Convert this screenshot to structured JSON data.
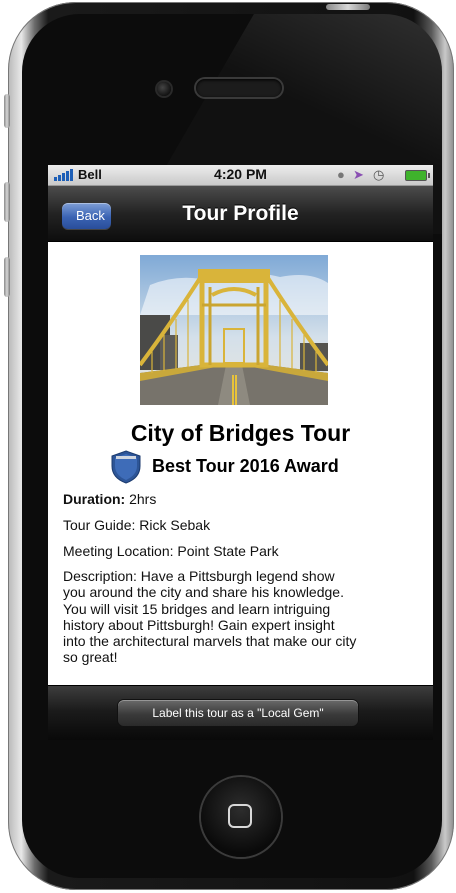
{
  "status_bar": {
    "carrier": "Bell",
    "time": "4:20 PM",
    "icons": [
      "lock-rotation-icon",
      "location-arrow-icon",
      "alarm-icon",
      "battery-icon"
    ]
  },
  "nav": {
    "back_label": "Back",
    "title": "Tour Profile"
  },
  "tour": {
    "image": "pittsburgh-yellow-bridge-photo",
    "title": "City of Bridges Tour",
    "award": "Best Tour 2016 Award",
    "duration_label": "Duration:",
    "duration_value": "2hrs",
    "guide": "Tour Guide: Rick Sebak",
    "meeting": "Meeting Location: Point State Park",
    "description_lines": [
      "Description: Have a Pittsburgh legend show",
      "you around the city and share his knowledge.",
      "You will visit 15 bridges and learn intriguing",
      "history about Pittsburgh! Gain expert insight",
      "into the architectural marvels that make our city",
      "so great!"
    ]
  },
  "toolbar": {
    "gem_button": "Label this tour as a \"Local Gem\""
  },
  "colors": {
    "back_button": "#3a63b3",
    "award_shield": "#2d5597",
    "bridge": "#d9b43a"
  }
}
